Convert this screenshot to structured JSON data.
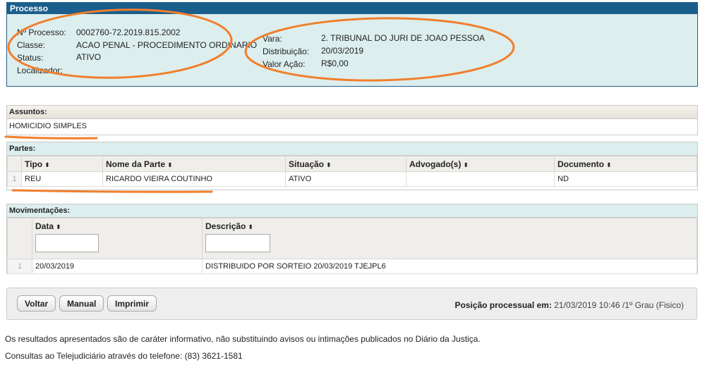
{
  "processo": {
    "header": "Processo",
    "numero_label": "Nº Processo:",
    "numero": "0002760-72.2019.815.2002",
    "classe_label": "Classe:",
    "classe": "ACAO PENAL - PROCEDIMENTO ORDINARIO",
    "status_label": "Status:",
    "status": "ATIVO",
    "localizador_label": "Localizador:",
    "vara_label": "Vara:",
    "vara": "2. TRIBUNAL DO JURI DE JOAO PESSOA",
    "distribuicao_label": "Distribuição:",
    "distribuicao": "20/03/2019",
    "valor_label": "Valor Ação:",
    "valor": "R$0,00"
  },
  "assuntos": {
    "header": "Assuntos:",
    "items": [
      "HOMICIDIO SIMPLES"
    ]
  },
  "partes": {
    "header": "Partes:",
    "columns": [
      "Tipo",
      "Nome da Parte",
      "Situação",
      "Advogado(s)",
      "Documento"
    ],
    "rows": [
      {
        "n": "1",
        "tipo": "REU",
        "nome": "RICARDO VIEIRA COUTINHO",
        "situacao": "ATIVO",
        "advogados": "",
        "documento": "ND"
      }
    ]
  },
  "movimentacoes": {
    "header": "Movimentações:",
    "columns": [
      "Data",
      "Descrição"
    ],
    "rows": [
      {
        "n": "1",
        "data": "20/03/2019",
        "descricao": "DISTRIBUIDO POR SORTEIO 20/03/2019 TJEJPL6"
      }
    ]
  },
  "toolbar": {
    "voltar": "Voltar",
    "manual": "Manual",
    "imprimir": "Imprimir",
    "posicao_label": "Posição processual em:",
    "posicao_value": "21/03/2019 10:46 /1º Grau (Fisico)"
  },
  "footer": {
    "line1": "Os resultados apresentados são de caráter informativo, não substituindo avisos ou intimações publicados no Diário da Justiça.",
    "line2": "Consultas ao Telejudiciário através do telefone: (83) 3621-1581"
  },
  "sort_icon": "sort-updown-icon",
  "colors": {
    "header_blue": "#1a5e8c",
    "panel_teal": "#ddeeee",
    "annotation_orange": "#f07f2c"
  }
}
